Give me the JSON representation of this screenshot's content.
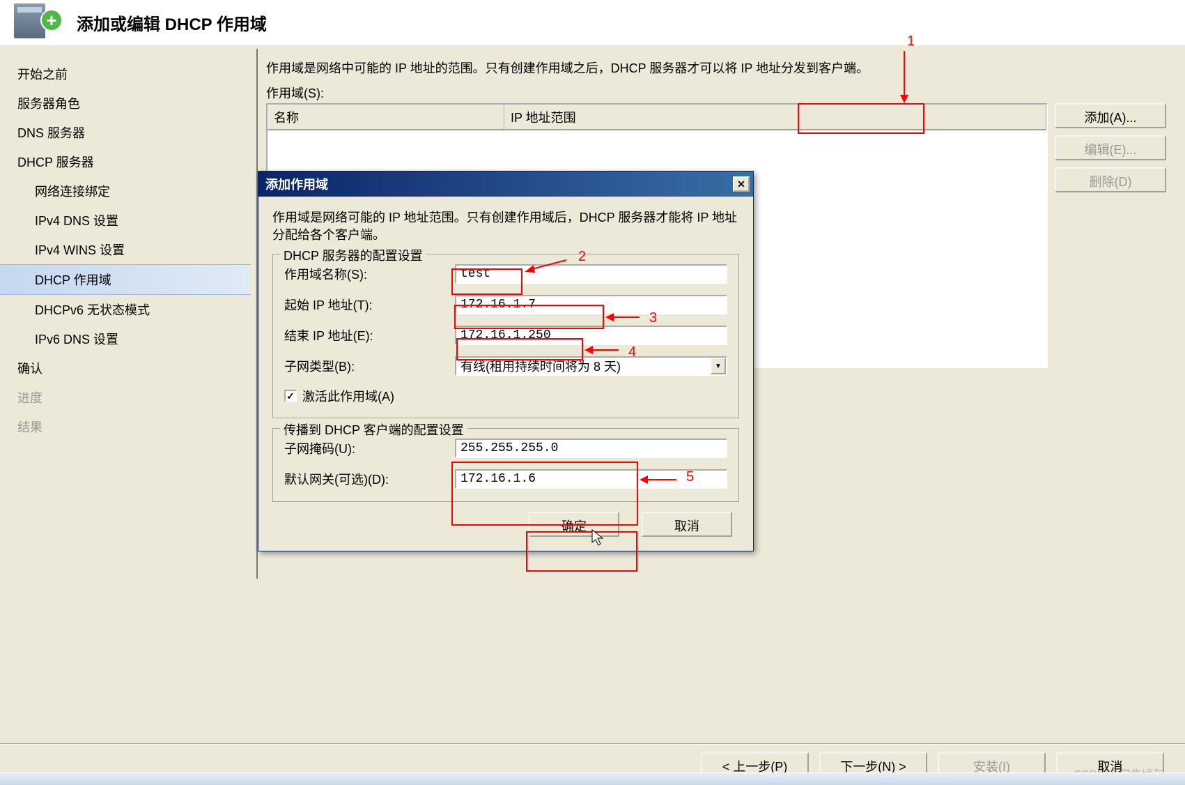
{
  "wizard": {
    "title": "添加或编辑 DHCP 作用域",
    "sidebar": [
      {
        "label": "开始之前",
        "indent": false
      },
      {
        "label": "服务器角色",
        "indent": false
      },
      {
        "label": "DNS 服务器",
        "indent": false
      },
      {
        "label": "DHCP 服务器",
        "indent": false
      },
      {
        "label": "网络连接绑定",
        "indent": true
      },
      {
        "label": "IPv4 DNS 设置",
        "indent": true
      },
      {
        "label": "IPv4 WINS 设置",
        "indent": true
      },
      {
        "label": "DHCP 作用域",
        "indent": true,
        "selected": true
      },
      {
        "label": "DHCPv6 无状态模式",
        "indent": true
      },
      {
        "label": "IPv6 DNS 设置",
        "indent": true
      },
      {
        "label": "确认",
        "indent": false
      },
      {
        "label": "进度",
        "indent": false,
        "disabled": true
      },
      {
        "label": "结果",
        "indent": false,
        "disabled": true
      }
    ],
    "description": "作用域是网络中可能的 IP 地址的范围。只有创建作用域之后，DHCP 服务器才可以将 IP 地址分发到客户端。",
    "scopes_label": "作用域(S):",
    "table": {
      "col_name": "名称",
      "col_range": "IP 地址范围"
    },
    "buttons": {
      "add": "添加(A)...",
      "edit": "编辑(E)...",
      "delete": "删除(D)"
    },
    "footer": {
      "prev": "< 上一步(P)",
      "next": "下一步(N) >",
      "install": "安装(I)",
      "cancel": "取消"
    }
  },
  "dialog": {
    "title": "添加作用域",
    "description": "作用域是网络可能的 IP 地址范围。只有创建作用域后，DHCP 服务器才能将 IP 地址分配给各个客户端。",
    "group1_title": "DHCP 服务器的配置设置",
    "group2_title": "传播到 DHCP 客户端的配置设置",
    "labels": {
      "scope_name": "作用域名称(S):",
      "start_ip": "起始 IP 地址(T):",
      "end_ip": "结束 IP 地址(E):",
      "subnet_type": "子网类型(B):",
      "activate": "激活此作用域(A)",
      "subnet_mask": "子网掩码(U):",
      "gateway": "默认网关(可选)(D):"
    },
    "values": {
      "scope_name": "test",
      "start_ip": "172.16.1.7",
      "end_ip": "172.16.1.250",
      "subnet_type": "有线(租用持续时间将为 8 天)",
      "subnet_mask": "255.255.255.0",
      "gateway": "172.16.1.6"
    },
    "buttons": {
      "ok": "确定",
      "cancel": "取消"
    }
  },
  "annotations": {
    "a1": "1",
    "a2": "2",
    "a3": "3",
    "a4": "4",
    "a5": "5"
  },
  "watermark": "CSDN @学生顷灰"
}
